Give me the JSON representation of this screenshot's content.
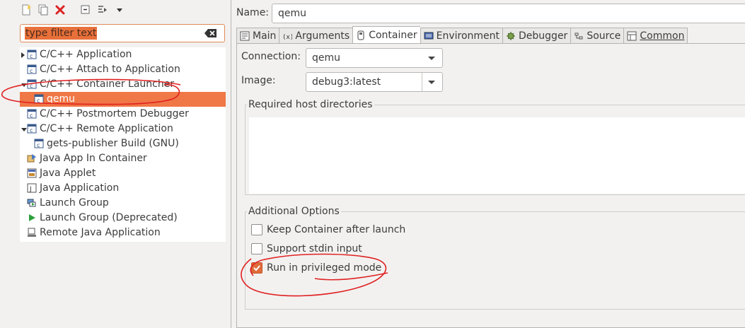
{
  "filter": {
    "placeholder": "type filter text"
  },
  "tree": [
    {
      "label": "C/C++ Application",
      "expanded": false,
      "hasChildren": true,
      "icon": "cdt-launch-icon"
    },
    {
      "label": "C/C++ Attach to Application",
      "icon": "cdt-launch-icon"
    },
    {
      "label": "C/C++ Container Launcher",
      "expanded": true,
      "hasChildren": true,
      "icon": "cdt-launch-icon"
    },
    {
      "label": "qemu",
      "child": true,
      "selected": true,
      "icon": "cdt-config-icon"
    },
    {
      "label": "C/C++ Postmortem Debugger",
      "icon": "cdt-launch-icon"
    },
    {
      "label": "C/C++ Remote Application",
      "expanded": true,
      "hasChildren": true,
      "icon": "cdt-launch-icon"
    },
    {
      "label": "gets-publisher Build (GNU)",
      "child": true,
      "icon": "cdt-config-icon"
    },
    {
      "label": "Java App In Container",
      "icon": "java-container-icon"
    },
    {
      "label": "Java Applet",
      "icon": "java-applet-icon"
    },
    {
      "label": "Java Application",
      "icon": "java-app-icon"
    },
    {
      "label": "Launch Group",
      "icon": "launch-group-icon"
    },
    {
      "label": "Launch Group (Deprecated)",
      "icon": "play-icon"
    },
    {
      "label": "Remote Java Application",
      "icon": "remote-java-icon"
    }
  ],
  "config": {
    "name_label": "Name:",
    "name_value": "qemu"
  },
  "tabs": [
    {
      "label": "Main",
      "icon": "main-tab-icon"
    },
    {
      "label": "Arguments",
      "icon": "arguments-icon"
    },
    {
      "label": "Container",
      "icon": "container-icon",
      "active": true
    },
    {
      "label": "Environment",
      "icon": "environment-icon"
    },
    {
      "label": "Debugger",
      "icon": "bug-icon"
    },
    {
      "label": "Source",
      "icon": "source-icon"
    },
    {
      "label": "Common",
      "icon": "common-icon"
    }
  ],
  "container": {
    "connection_label": "Connection:",
    "connection_value": "qemu",
    "image_label": "Image:",
    "image_value": "debug3:latest",
    "host_dirs_title": "Required host directories",
    "options_title": "Additional Options",
    "options": [
      {
        "label": "Keep Container after launch",
        "checked": false
      },
      {
        "label": "Support stdin input",
        "checked": false
      },
      {
        "label": "Run in privileged mode",
        "checked": true
      }
    ]
  },
  "colors": {
    "selection": "#f07746",
    "accent": "#e06b3a",
    "annotation": "#e02020"
  }
}
